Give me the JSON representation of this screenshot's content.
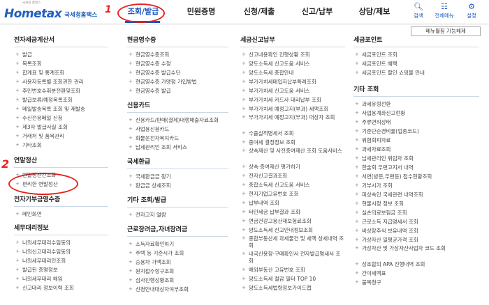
{
  "header": {
    "logo_main": "Hometax",
    "logo_sub": "국세청홈택스",
    "logo_top": "국세청 홈택스",
    "nav": [
      "조회/발급",
      "민원증명",
      "신청/제출",
      "신고/납부",
      "상담/제보"
    ],
    "active_nav": "조회/발급",
    "search_label": "검색",
    "all_menu_label": "전체메뉴",
    "settings_label": "설정",
    "menu_toggle_btn": "메뉴펼침 기능해제"
  },
  "annotations": {
    "mark1": "1",
    "mark2": "2"
  },
  "columns": [
    {
      "sections": [
        {
          "title": "전자세금계산서",
          "items": [
            "발급",
            "목록조회",
            "합계표 및 통계조회",
            "사용자등록별 조회권한 관리",
            "주민번호수취분전환및조회",
            "발급보류/예정목록조회",
            "메일발송목록 조회 및 재발송",
            "수신전용메일 신청",
            "제3자 발급사실 조회",
            "거래처 및 품목관리",
            "기타조회"
          ]
        },
        {
          "title": "연말정산",
          "items": [
            "연말정산간소화",
            "편리한 연말정산"
          ]
        },
        {
          "title": "전자기부금영수증",
          "items": [
            "메인화면"
          ]
        },
        {
          "title": "세무대리정보",
          "items": [
            "나의세무대리수임동의",
            "나의신고대리수임동의",
            "나의세무대리인조회",
            "발급된 증명정보",
            "나의세무대리 해임",
            "신고대리 정보이력 조회"
          ]
        }
      ]
    },
    {
      "sections": [
        {
          "title": "현금영수증",
          "items": [
            "현금영수증조회",
            "현금영수증 수정",
            "현금영수증 발급수단",
            "현금영수증 가맹점 가입방법",
            "현금영수증 발급"
          ]
        },
        {
          "title": "신용카드",
          "items": [
            "신용카드/판매(결제)대행매출자료조회",
            "사업용신용카드",
            "화물운전자복지카드",
            "납세관리인 조회 서비스"
          ]
        },
        {
          "title": "국세환급",
          "items": [
            "국세환급금 찾기",
            "환급금 상세조회"
          ]
        },
        {
          "title": "기타 조회/발급",
          "items": [
            "전자고지 열람"
          ]
        },
        {
          "title": "근로장려금,자녀장려금",
          "items": [
            "소득자료확인하기",
            "주택 등 기준시가 조회",
            "승용차 가액조회",
            "원지접수항구조회",
            "심사진행상황조회",
            "신청안내대상자여부조회"
          ]
        }
      ]
    },
    {
      "sections": [
        {
          "title": "세금신고납부",
          "items": [
            "신고내용확인 진행상황 조회",
            "양도소득세 신고도움 서비스",
            "양도소득세 종합안내",
            "부가가치세매입자납부특례조회",
            "부가가치세 신고도움 서비스",
            "부가가치세 카드사 대리납부 조회",
            "부가가치세 예정고지(부과) 세액조회",
            "부가가치세 예정고지(부과) 대상자 조회",
            "수출실적명세서 조회",
            "중여세 결정정보 조회",
            "상속재산 및 사전증여재산 조회 도움서비스",
            "상속·증여재산 평가하기",
            "전자신고결과조회",
            "종합소득세 신고도움 서비스",
            "현지기업고유번호 조회",
            "납부내역 조회",
            "타인세금 납부결과 조회",
            "연금건강고용산재보험료조회",
            "양도소득세 신고안내정보조회",
            "종합부동산세 과세물건 및 세액 상세내역 조회",
            "내국신용장·구매확인서 전자발급명세서 조회",
            "해외부동산 고유번호 조회",
            "양도소득세 절감 필터 TOP 10",
            "양도소득세법령정보가이드맵"
          ]
        }
      ]
    },
    {
      "sections": [
        {
          "title": "세금포인트",
          "items": [
            "세금포인트 조회",
            "세금포인트 혜택",
            "세금포인트 할인 쇼핑몰 안내"
          ]
        },
        {
          "title": "기타 조회",
          "items": [
            "과세유형전환",
            "사업용계좌신고현황",
            "주류면허상태",
            "기준단순경비율(업종코드)",
            "위험회피자료",
            "과세자료조회",
            "납세관리인 위임자 조회",
            "한술회 우편고지서 내역",
            "서면(방문,우편등) 접수현황조회",
            "기부시가 조회",
            "피상속인 국세관련 내역조회",
            "현물시정 정보 조회",
            "실손의료보험금 조회",
            "근로소득 지급명세서 조회",
            "비상장주식 보유내역 조회",
            "가상자산 일평균가격 조회",
            "가상자산 및 가상자산사업자 코드 조회",
            "상호합의 APA 진행내역 조회",
            "간이세액표",
            "불복청구"
          ]
        }
      ]
    }
  ]
}
